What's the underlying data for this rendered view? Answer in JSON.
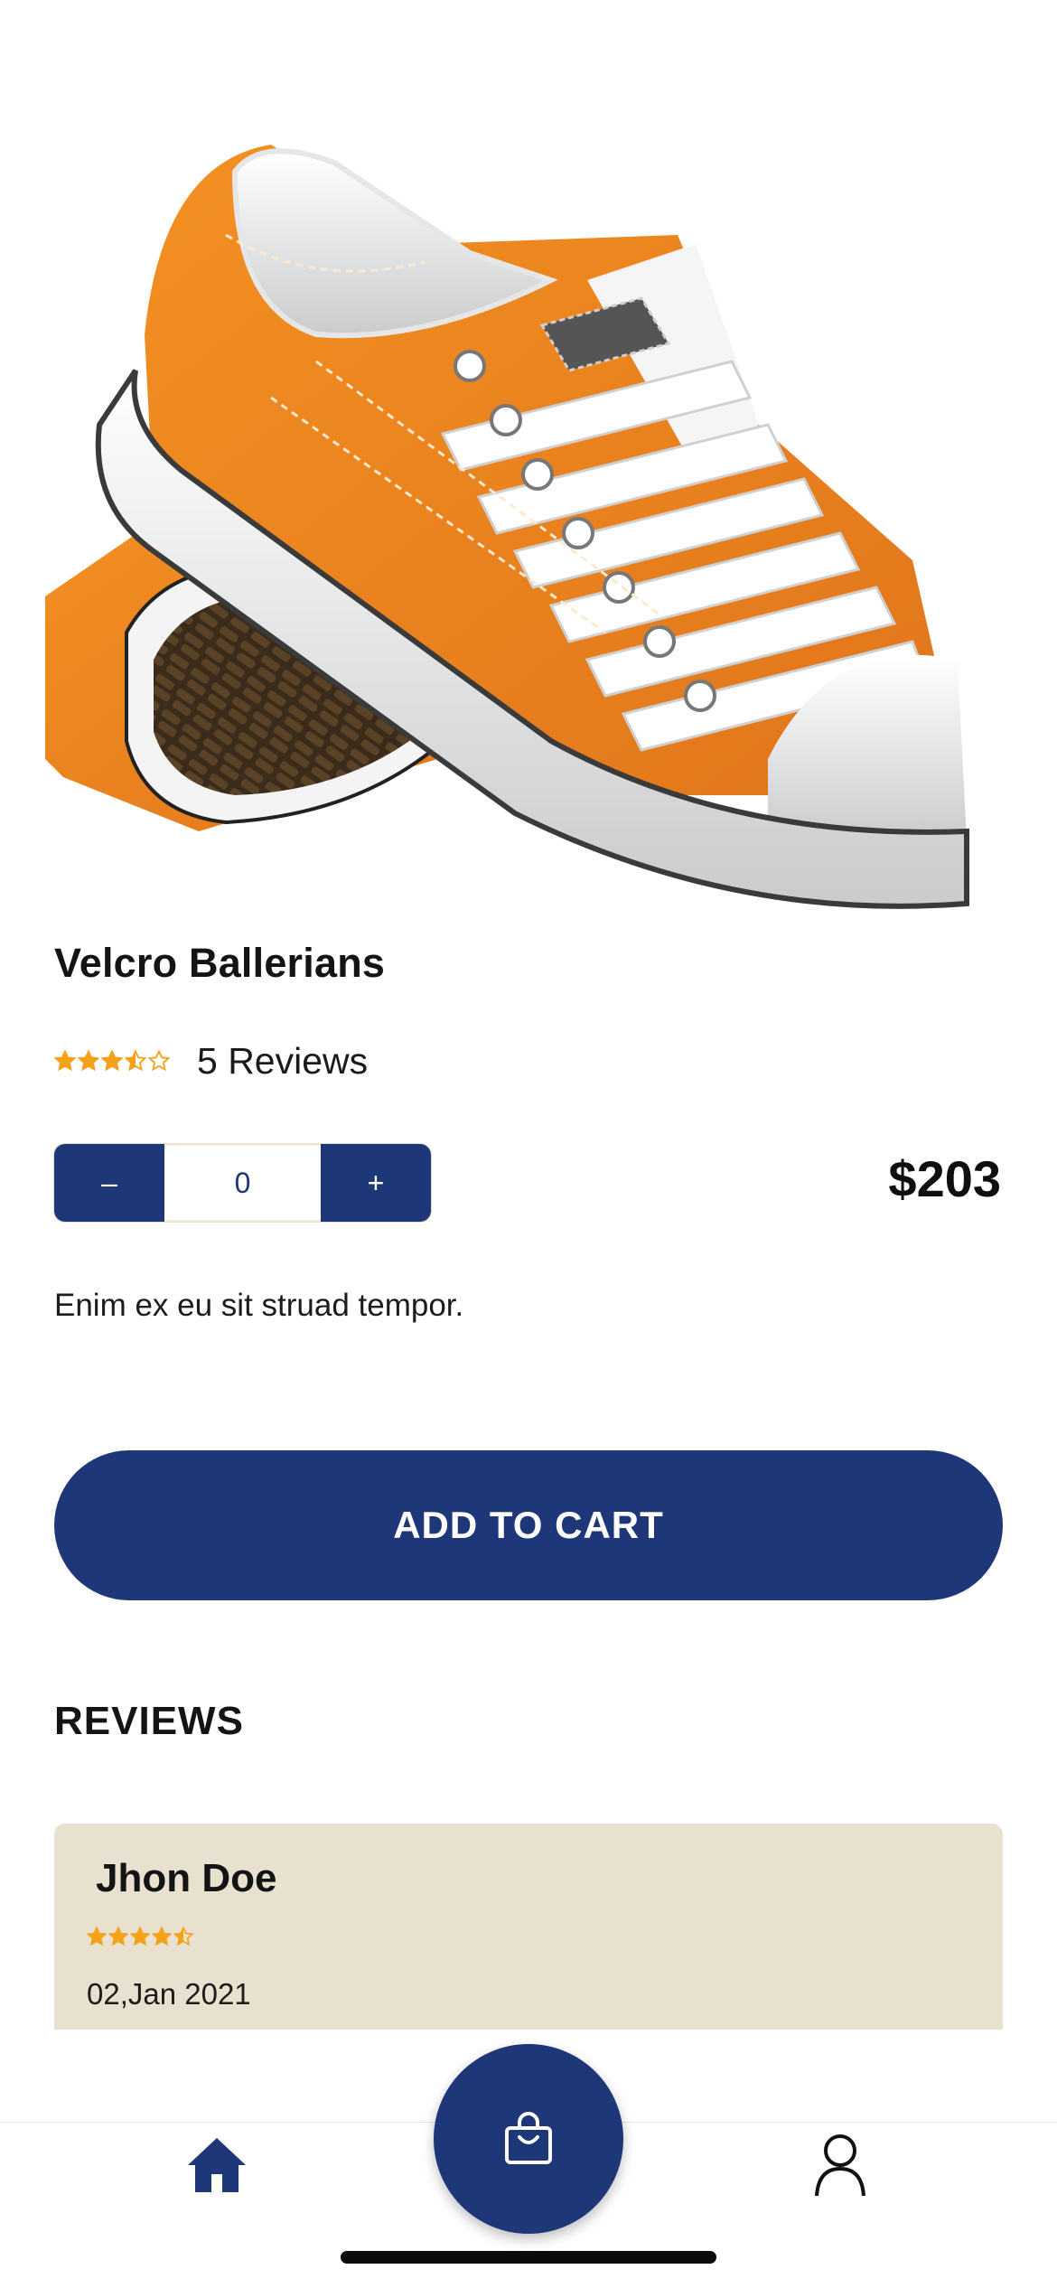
{
  "product": {
    "image_alt": "Orange canvas sneakers",
    "title": "Velcro Ballerians",
    "rating": 3.5,
    "rating_max": 5,
    "reviews_label": "5 Reviews",
    "quantity": "0",
    "minus_label": "–",
    "plus_label": "+",
    "price": "$203",
    "description": "Enim ex eu sit struad tempor."
  },
  "actions": {
    "add_to_cart_label": "ADD TO CART"
  },
  "reviews": {
    "heading": "REVIEWS",
    "items": [
      {
        "author": "Jhon Doe",
        "rating": 4.5,
        "date": "02,Jan 2021"
      }
    ]
  },
  "tab_bar": {
    "items": [
      {
        "icon": "home-icon",
        "active": true
      },
      {
        "icon": "shopping-bag-icon",
        "active": false
      },
      {
        "icon": "user-icon",
        "active": false
      }
    ]
  },
  "colors": {
    "primary": "#1e3778",
    "star": "#f5a21b",
    "card_bg": "#e8e1cf",
    "shoe_orange": "#f08a1f"
  }
}
